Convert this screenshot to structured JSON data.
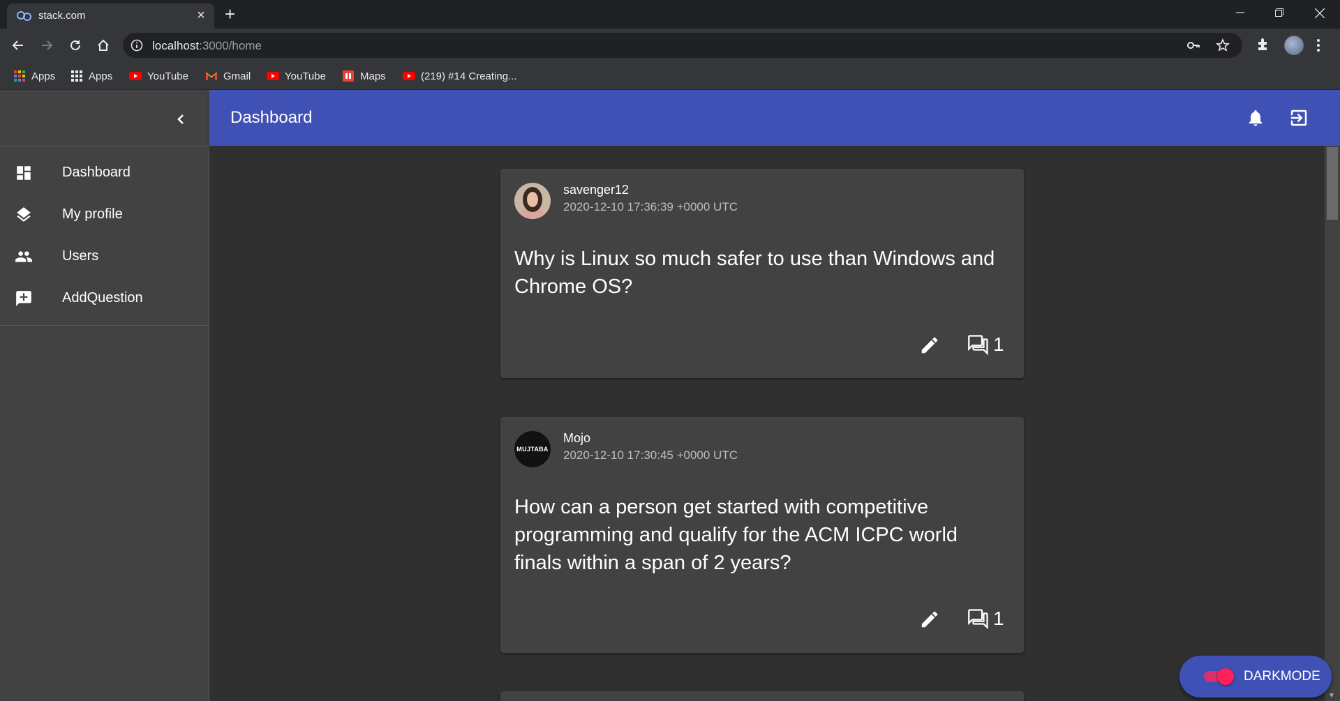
{
  "browser": {
    "tab_title": "stack.com",
    "url_host": "localhost",
    "url_path": ":3000/home",
    "bookmarks": [
      {
        "label": "Apps",
        "icon": "apps-grid-color-icon"
      },
      {
        "label": "Apps",
        "icon": "apps-grid-icon"
      },
      {
        "label": "YouTube",
        "icon": "youtube-icon"
      },
      {
        "label": "Gmail",
        "icon": "gmail-icon"
      },
      {
        "label": "YouTube",
        "icon": "youtube-icon"
      },
      {
        "label": "Maps",
        "icon": "maps-icon"
      },
      {
        "label": "(219) #14 Creating...",
        "icon": "youtube-icon"
      }
    ]
  },
  "sidebar": {
    "items": [
      {
        "label": "Dashboard",
        "icon": "dashboard-icon"
      },
      {
        "label": "My profile",
        "icon": "layers-icon"
      },
      {
        "label": "Users",
        "icon": "people-icon"
      },
      {
        "label": "AddQuestion",
        "icon": "add-comment-icon"
      }
    ]
  },
  "appbar": {
    "title": "Dashboard"
  },
  "posts": [
    {
      "author": "savenger12",
      "timestamp": "2020-12-10 17:36:39 +0000 UTC",
      "question": "Why is Linux so much safer to use than Windows and Chrome OS?",
      "comment_count": "1"
    },
    {
      "author": "Mojo",
      "avatar_text": "MUJTABA",
      "timestamp": "2020-12-10 17:30:45 +0000 UTC",
      "question": "How can a person get started with competitive programming and qualify for the ACM ICPC world finals within a span of 2 years?",
      "comment_count": "1"
    }
  ],
  "darkmode": {
    "label": "DARKMODE",
    "enabled": true
  },
  "colors": {
    "appbar": "#3f51b5",
    "sidebar": "#424242",
    "background": "#303030",
    "card": "#424242",
    "toggle": "#ff1f5a"
  }
}
